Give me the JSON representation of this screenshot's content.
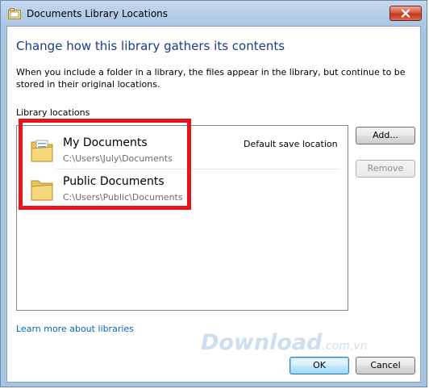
{
  "window": {
    "title": "Documents Library Locations",
    "close_symbol": "✕"
  },
  "main": {
    "heading": "Change how this library gathers its contents",
    "description": "When you include a folder in a library, the files appear in the library, but continue to be stored in their original locations.",
    "list_label": "Library locations",
    "locations": [
      {
        "name": "My Documents",
        "path": "C:\\Users\\July\\Documents",
        "tag": "Default save location",
        "icon": "documents-folder-icon"
      },
      {
        "name": "Public Documents",
        "path": "C:\\Users\\Public\\Documents",
        "icon": "folder-icon"
      }
    ],
    "learn_more": "Learn more about libraries"
  },
  "buttons": {
    "add": "Add...",
    "remove": "Remove",
    "ok": "OK",
    "cancel": "Cancel"
  },
  "watermark": {
    "brand": "Download",
    "suffix": ".com.vn"
  },
  "colors": {
    "heading": "#1e3a8a",
    "link": "#0066cc",
    "highlight": "#e8141b"
  }
}
